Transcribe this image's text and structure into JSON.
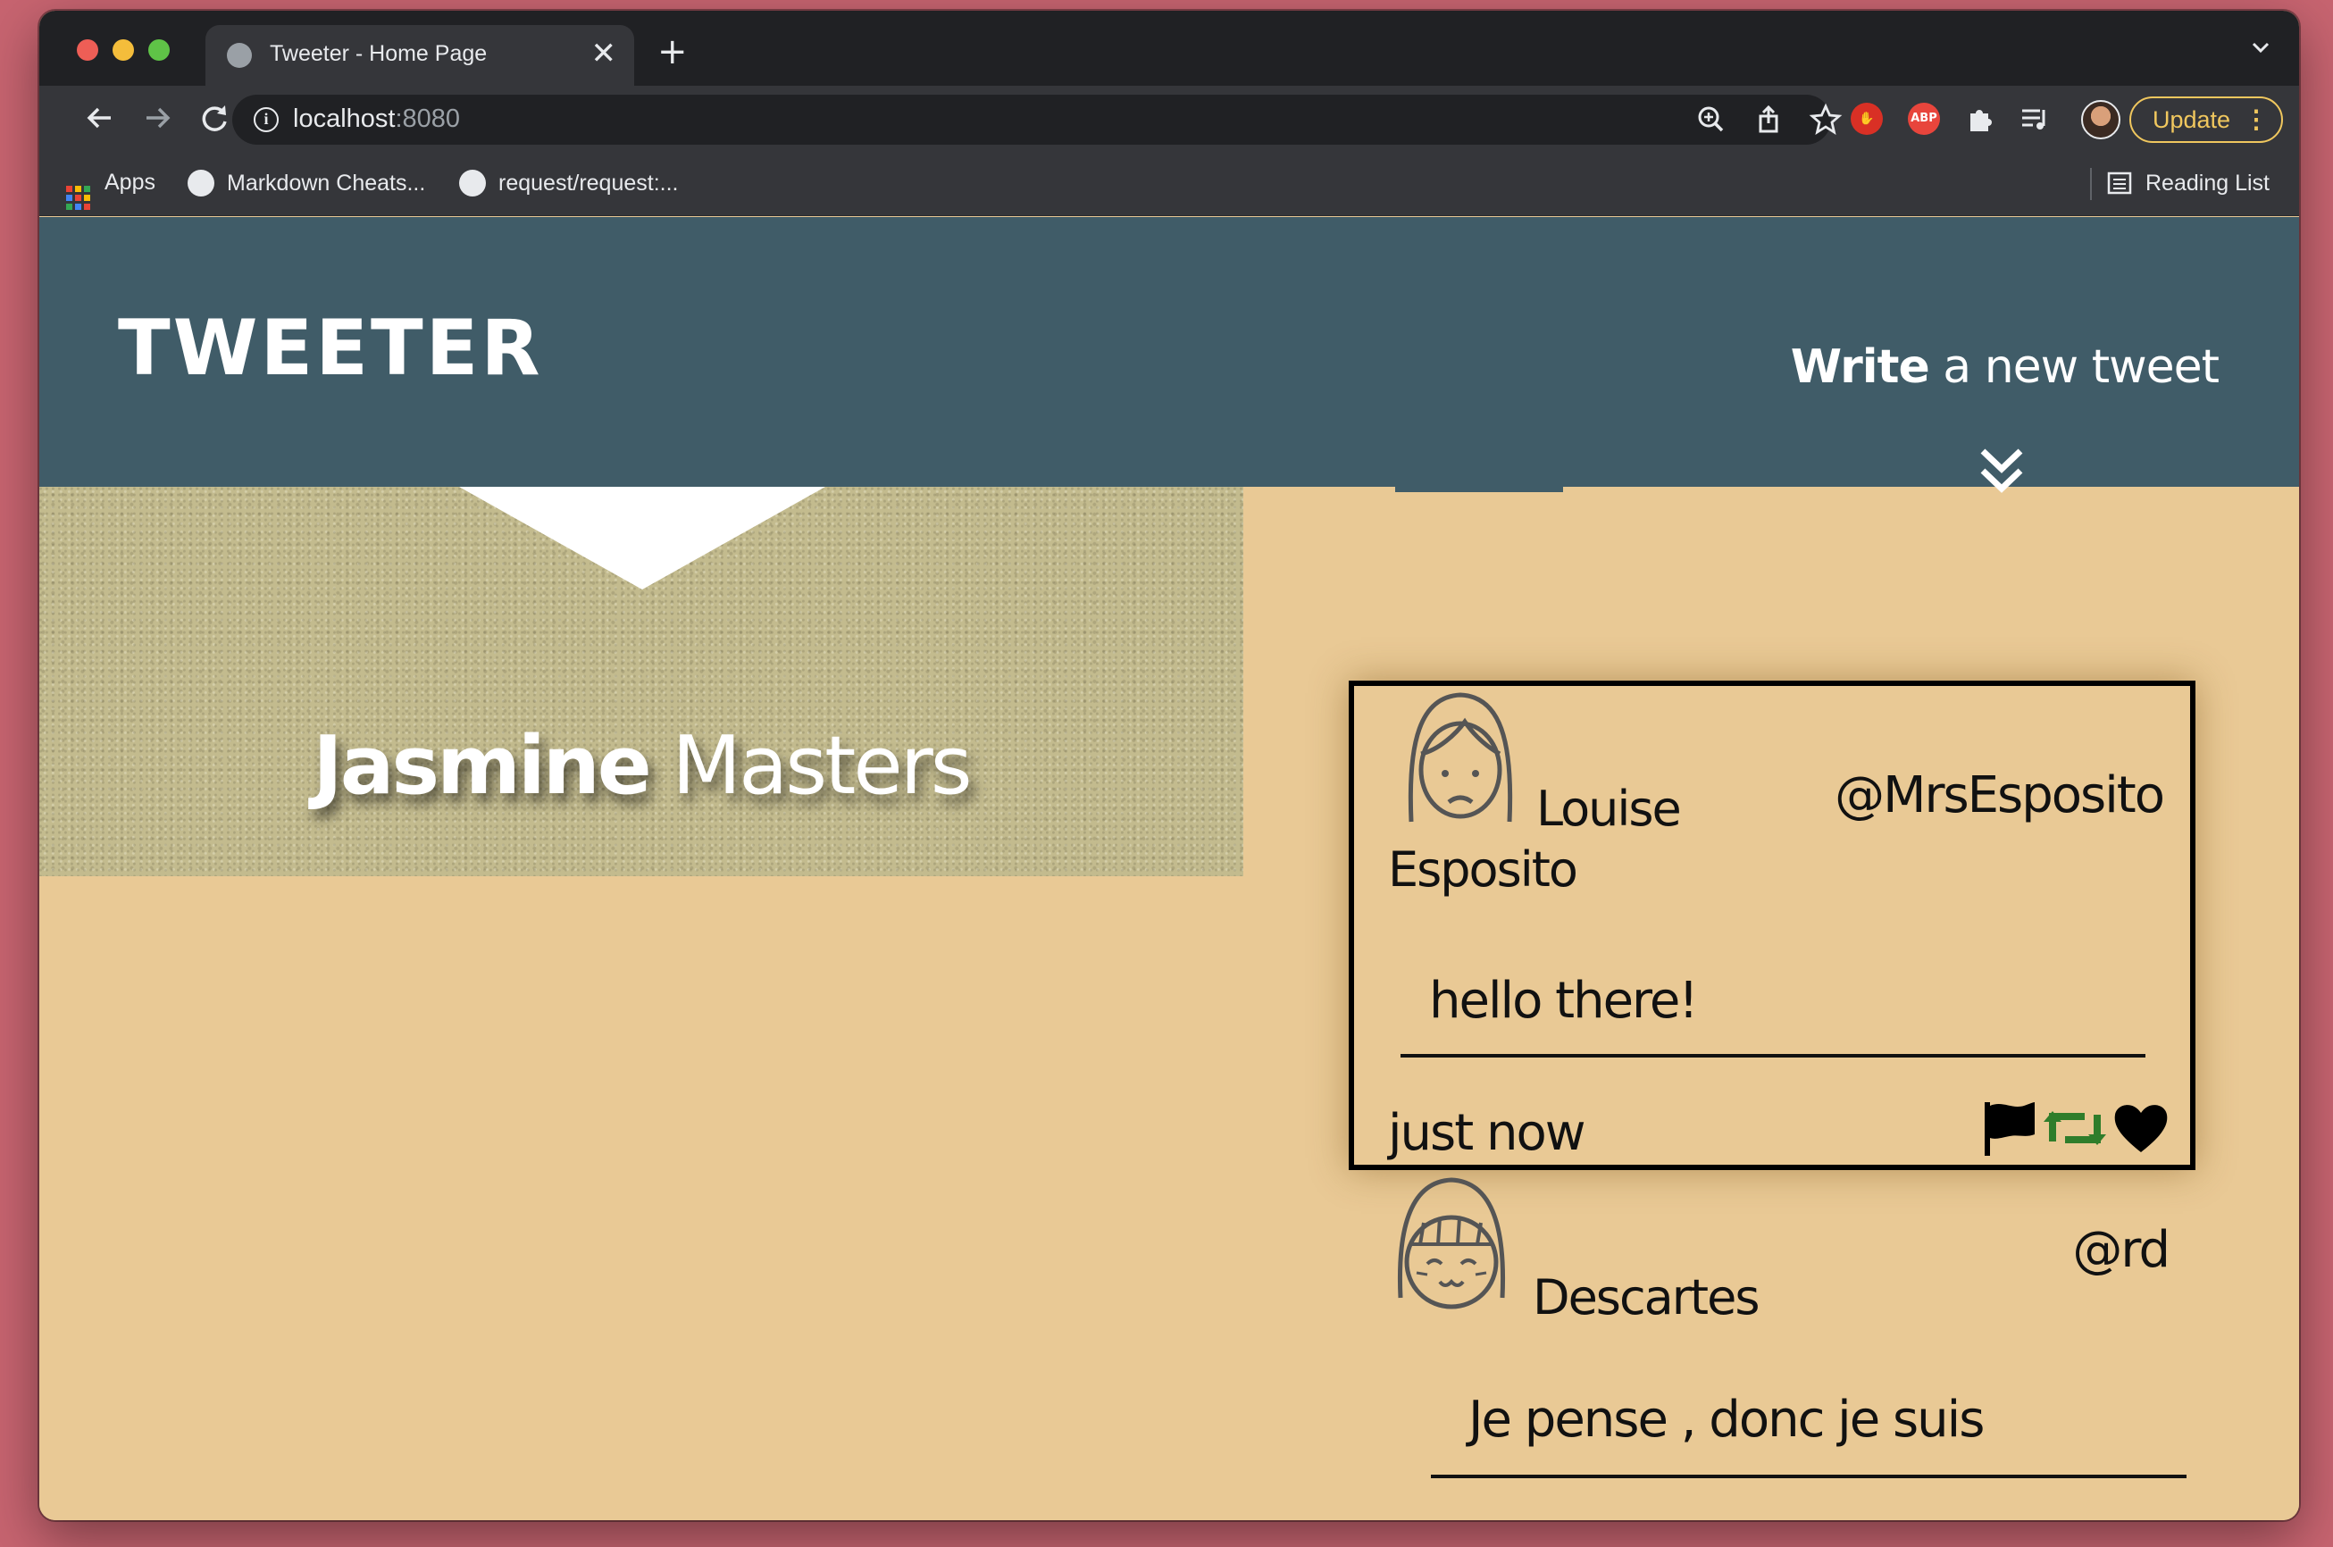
{
  "browser": {
    "tab_title": "Tweeter - Home Page",
    "new_tab_symbol": "+",
    "close_symbol": "✕",
    "url_host": "localhost",
    "url_port": ":8080",
    "update_label": "Update",
    "ext_abp_label": "ABP",
    "bookmarks": {
      "apps": "Apps",
      "item1": "Markdown Cheats...",
      "item2": "request/request:...",
      "reading_list": "Reading List"
    }
  },
  "nav": {
    "logo": "TWEETER",
    "compose_bold": "Write",
    "compose_rest": " a new tweet"
  },
  "profile": {
    "first_name": "Jasmine",
    "last_name": " Masters"
  },
  "tweets": [
    {
      "name": "Louise Esposito",
      "handle": "@MrsEsposito",
      "text": "hello there!",
      "time": "just now"
    },
    {
      "name": "Descartes",
      "handle": "@rd",
      "text": "Je pense , donc je suis"
    }
  ],
  "colors": {
    "nav_bg": "#405c68",
    "page_bg": "#e9c995",
    "retweet_green": "#2f7d2b"
  }
}
